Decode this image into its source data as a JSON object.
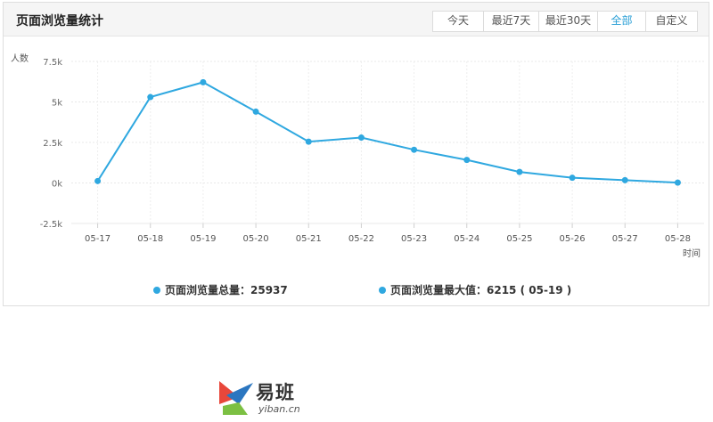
{
  "panel": {
    "title": "页面浏览量统计",
    "range_tabs": [
      "今天",
      "最近7天",
      "最近30天",
      "全部",
      "自定义"
    ],
    "active_tab": "全部"
  },
  "chart_data": {
    "type": "line",
    "ylabel": "人数",
    "xlabel": "时间",
    "ylim": [
      -2500,
      7500
    ],
    "yticks": [
      -2500,
      0,
      2500,
      5000,
      7500
    ],
    "ytick_labels": [
      "-2.5k",
      "0k",
      "2.5k",
      "5k",
      "7.5k"
    ],
    "categories": [
      "05-17",
      "05-18",
      "05-19",
      "05-20",
      "05-21",
      "05-22",
      "05-23",
      "05-24",
      "05-25",
      "05-26",
      "05-27",
      "05-28"
    ],
    "series": [
      {
        "values": [
          120,
          5300,
          6215,
          4400,
          2550,
          2800,
          2050,
          1420,
          680,
          320,
          170,
          20
        ],
        "color": "#2fa8e0"
      }
    ],
    "grid": true
  },
  "legend": {
    "total": "页面浏览量总量：25937",
    "max": "页面浏览量最大值：6215 ( 05-19 )"
  },
  "logo": {
    "name": "易班",
    "url": "yiban.cn"
  }
}
